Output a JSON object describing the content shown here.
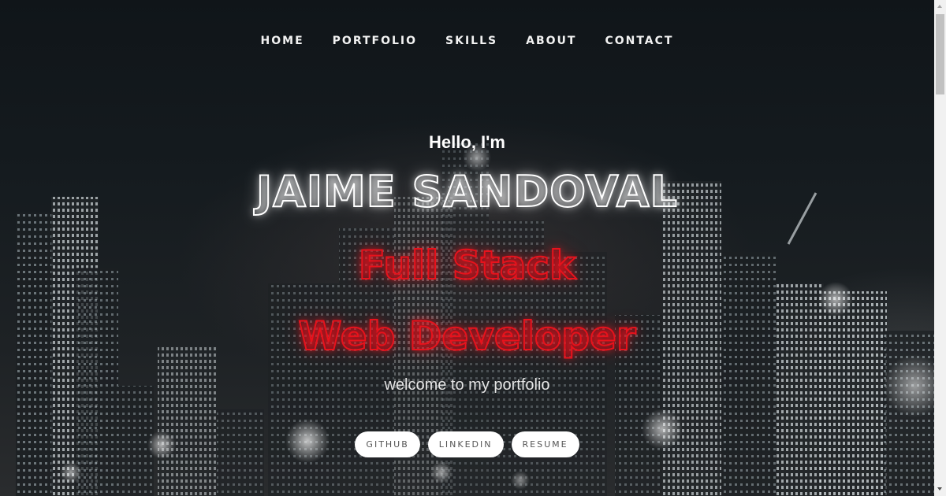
{
  "nav": {
    "items": [
      {
        "label": "HOME"
      },
      {
        "label": "PORTFOLIO"
      },
      {
        "label": "SKILLS"
      },
      {
        "label": "ABOUT"
      },
      {
        "label": "CONTACT"
      }
    ]
  },
  "hero": {
    "greeting": "Hello, I'm",
    "name": "JAIME SANDOVAL",
    "role_line1": "Full Stack",
    "role_line2": "Web Developer",
    "tagline": "welcome to my portfolio"
  },
  "buttons": {
    "github": "GITHUB",
    "linkedin": "LINKEDIN",
    "resume": "RESUME"
  },
  "colors": {
    "name_neon": "#ffffff",
    "role_neon": "#e8121c",
    "button_bg": "#ffffff",
    "background": "#101519"
  }
}
